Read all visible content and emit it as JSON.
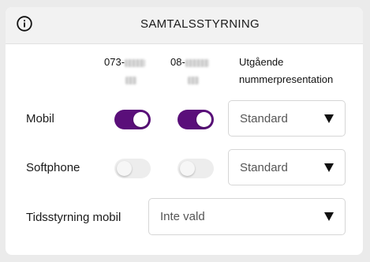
{
  "header": {
    "title": "SAMTALSSTYRNING",
    "info_icon": "info-icon"
  },
  "columns": {
    "number1_prefix": "073-",
    "number2_prefix": "08-",
    "presentation_line1": "Utgående",
    "presentation_line2": "nummerpresentation"
  },
  "rows": [
    {
      "label": "Mobil",
      "toggle1": "on",
      "toggle2": "on",
      "select_value": "Standard"
    },
    {
      "label": "Softphone",
      "toggle1": "off",
      "toggle2": "off",
      "select_value": "Standard"
    }
  ],
  "schedule": {
    "label": "Tidsstyrning mobil",
    "select_value": "Inte vald"
  },
  "colors": {
    "toggle_on": "#5a0f7a",
    "toggle_off": "#ededed",
    "header_bg": "#f2f2f2"
  }
}
